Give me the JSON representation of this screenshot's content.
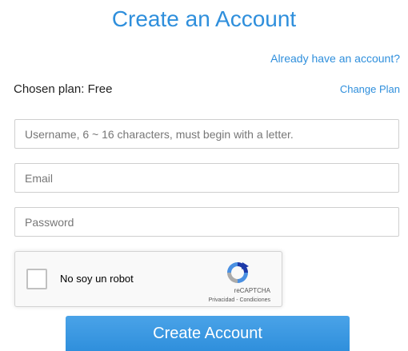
{
  "header": {
    "title": "Create an Account",
    "login_link": "Already have an account?"
  },
  "plan": {
    "label": "Chosen plan: Free",
    "change_link": "Change Plan"
  },
  "form": {
    "username_placeholder": "Username, 6 ~ 16 characters, must begin with a letter.",
    "username_value": "",
    "email_placeholder": "Email",
    "email_value": "",
    "password_placeholder": "Password",
    "password_value": ""
  },
  "captcha": {
    "label": "No soy un robot",
    "brand": "reCAPTCHA",
    "terms": "Privacidad - Condiciones",
    "checked": false,
    "icon": "recaptcha-logo-icon"
  },
  "submit": {
    "label": "Create Account"
  },
  "colors": {
    "accent": "#2f8fdc",
    "text": "#222222",
    "border": "#cfcfcf",
    "captcha_bg": "#f9f9f9"
  }
}
